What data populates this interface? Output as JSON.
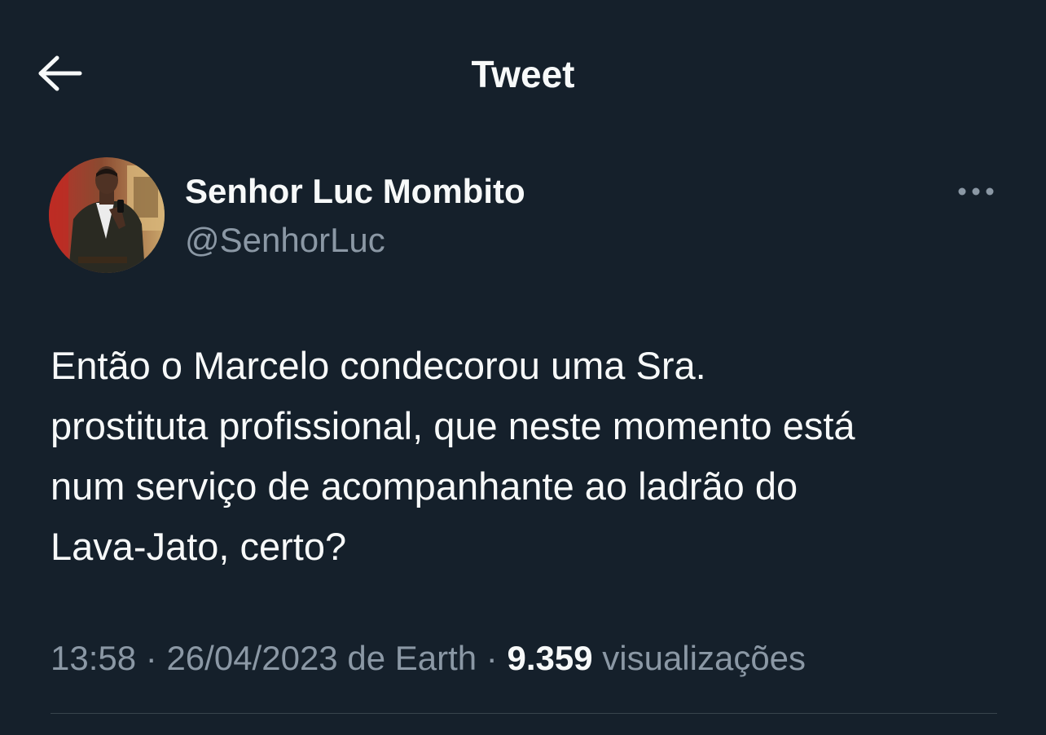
{
  "header": {
    "back_icon": "arrow-left-icon",
    "title": "Tweet"
  },
  "author": {
    "display_name": "Senhor Luc Mombito",
    "handle": "@SenhorLuc",
    "avatar_icon": "profile-photo",
    "more_icon": "more-horizontal-icon"
  },
  "tweet": {
    "lines": [
      "Então o Marcelo condecorou uma Sra.",
      "prostituta profissional, que neste momento está",
      "num serviço de acompanhante ao ladrão do",
      "Lava-Jato, certo?"
    ]
  },
  "meta": {
    "time": "13:58",
    "separator": "·",
    "date": "26/04/2023",
    "source_prefix": "de",
    "source": "Earth",
    "views_count": "9.359",
    "views_label": "visualizações"
  },
  "colors": {
    "background": "#15202b",
    "text_primary": "#f7f9f9",
    "text_secondary": "#8b98a5",
    "divider": "#38444d"
  }
}
